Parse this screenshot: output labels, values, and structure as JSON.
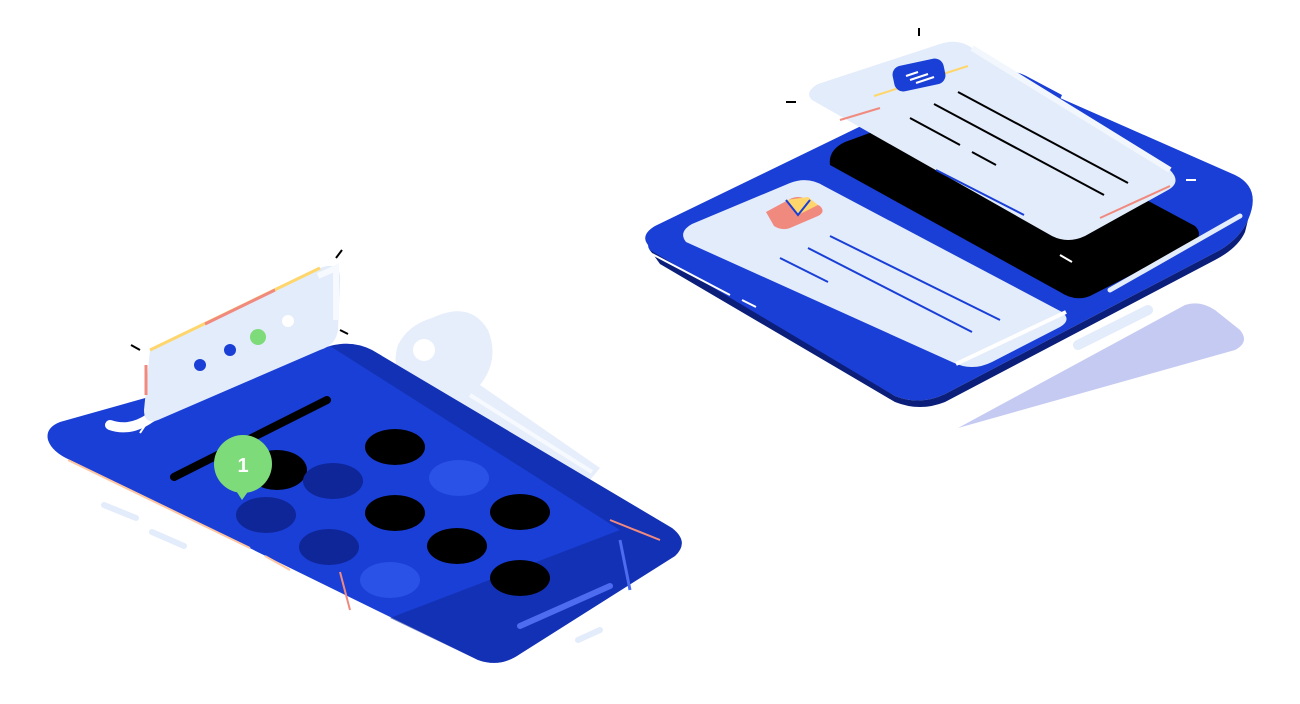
{
  "illustration": {
    "colors": {
      "background": "#ffffff",
      "phone_blue": "#1A3FD6",
      "phone_blue_dark": "#0F2699",
      "phone_blue_shadow": "#0B1E7A",
      "screen_black": "#000000",
      "card_light": "#E3ECFB",
      "card_highlight": "#F2F6FD",
      "key_light": "#E6EEFB",
      "shadow_lilac": "#C5CAF2",
      "badge_green": "#7DDB7A",
      "accent_yellow": "#FFD66B",
      "accent_red": "#F08A7E"
    },
    "left_phone": {
      "notification_badge_count": "1",
      "icons": [
        "lock-keypad-icon",
        "key-icon",
        "notification-bubble-icon",
        "password-dots-card-icon"
      ]
    },
    "right_phone": {
      "icons": [
        "message-card-icon",
        "envelope-icon",
        "chat-bubble-icon"
      ]
    }
  }
}
